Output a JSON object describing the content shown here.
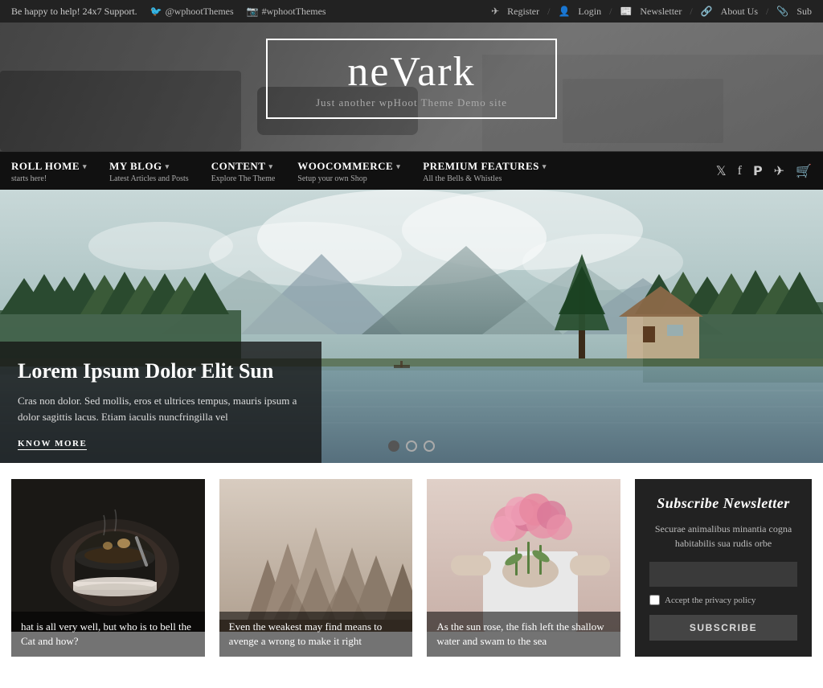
{
  "topbar": {
    "support_text": "Be happy to help! 24x7 Support.",
    "twitter_handle": "@wphootThemes",
    "instagram_handle": "#wphootThemes",
    "register_label": "Register",
    "login_label": "Login",
    "newsletter_label": "Newsletter",
    "about_label": "About Us",
    "sub_label": "Sub"
  },
  "header": {
    "logo_title": "neVark",
    "logo_subtitle": "Just another wpHoot Theme Demo site"
  },
  "nav": {
    "items": [
      {
        "id": "roll-home",
        "title": "ROLL HOME",
        "subtitle": "starts here!",
        "has_arrow": true
      },
      {
        "id": "my-blog",
        "title": "MY BLOG",
        "subtitle": "Latest Articles and Posts",
        "has_arrow": true
      },
      {
        "id": "content",
        "title": "CONTENT",
        "subtitle": "Explore The Theme",
        "has_arrow": true
      },
      {
        "id": "woocommerce",
        "title": "WOOCOMMERCE",
        "subtitle": "Setup your own Shop",
        "has_arrow": true
      },
      {
        "id": "premium-features",
        "title": "PREMIUM FEATURES",
        "subtitle": "All the Bells & Whistles",
        "has_arrow": true
      }
    ],
    "social_icons": [
      "twitter",
      "facebook",
      "pinterest",
      "tripadvisor",
      "cart"
    ]
  },
  "hero": {
    "title": "Lorem Ipsum Dolor Elit Sun",
    "text": "Cras non dolor. Sed mollis, eros et ultrices tempus, mauris ipsum a dolor sagittis lacus. Etiam iaculis nuncfringilla vel",
    "cta_label": "KNOW MORE",
    "dots": [
      {
        "active": true
      },
      {
        "active": false
      },
      {
        "active": false
      }
    ]
  },
  "cards": [
    {
      "id": "card-food",
      "text": "hat is all very well, but who is to bell the Cat and how?"
    },
    {
      "id": "card-mountain",
      "text": "Even the weakest may find means to avenge a wrong to make it right"
    },
    {
      "id": "card-flower",
      "text": "As the sun rose, the fish left the shallow water and swam to the sea"
    }
  ],
  "newsletter": {
    "title": "Subscribe Newsletter",
    "text": "Securae animalibus minantia cogna habitabilis sua rudis orbe",
    "email_placeholder": "",
    "privacy_label": "Accept the privacy policy",
    "submit_label": "SUBSCRIBE"
  }
}
